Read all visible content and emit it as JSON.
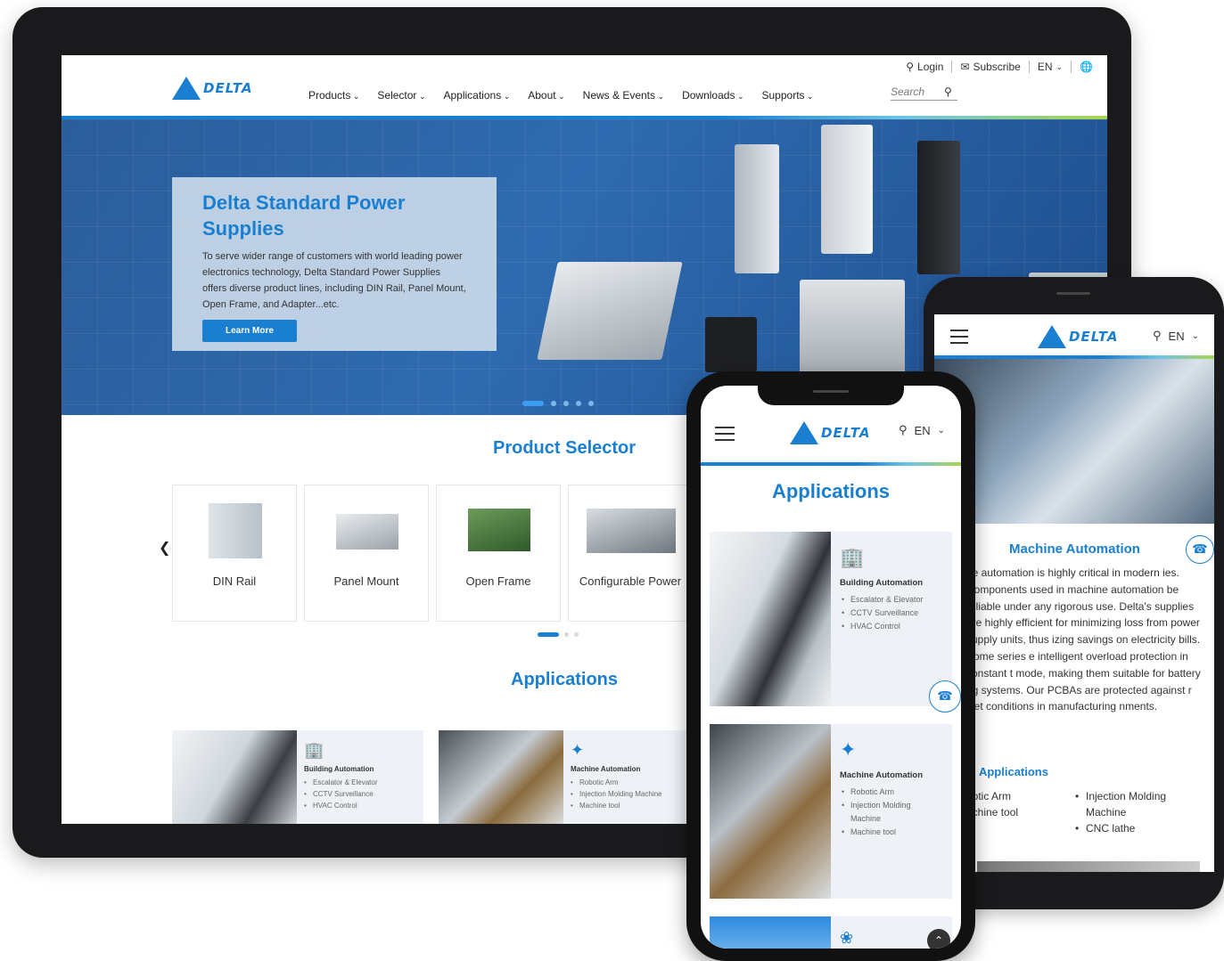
{
  "desktop": {
    "utility": {
      "login": "Login",
      "subscribe": "Subscribe",
      "language": "EN"
    },
    "logo_text": "DELTA",
    "nav": [
      "Products",
      "Selector",
      "Applications",
      "About",
      "News & Events",
      "Downloads",
      "Supports"
    ],
    "search_placeholder": "Search",
    "hero": {
      "title": "Delta Standard Power Supplies",
      "text": "To serve wider range of customers with world leading power electronics technology, Delta Standard Power Supplies offers diverse product lines, including DIN Rail, Panel Mount, Open Frame, and Adapter...etc.",
      "button": "Learn More"
    },
    "product_selector": {
      "title": "Product Selector",
      "cards": [
        "DIN Rail",
        "Panel Mount",
        "Open Frame",
        "Configurable Power"
      ]
    },
    "applications": {
      "title": "Applications",
      "items": [
        {
          "name": "Building Automation",
          "bullets": [
            "Escalator & Elevator",
            "CCTV Surveillance",
            "HVAC Control"
          ]
        },
        {
          "name": "Machine Automation",
          "bullets": [
            "Robotic Arm",
            "Injection Molding Machine",
            "Machine tool"
          ]
        }
      ]
    }
  },
  "tablet": {
    "logo_text": "DELTA",
    "language": "EN",
    "title": "Machine Automation",
    "body": "ne automation is highly critical in modern ies. Components used in machine automation be reliable under any rigorous use. Delta's supplies are highly efficient for minimizing loss from power supply units, thus izing savings on electricity bills. Some series e intelligent overload protection in constant t mode, making them suitable for battery ng systems. Our PCBAs are protected against r wet conditions in manufacturing nments.",
    "sub_title": "al Applications",
    "list_left": [
      "botic Arm",
      "achine tool"
    ],
    "list_right": [
      "Injection Molding Machine",
      "CNC lathe"
    ]
  },
  "phone": {
    "logo_text": "DELTA",
    "language": "EN",
    "title": "Applications",
    "cards": [
      {
        "name": "Building Automation",
        "bullets": [
          "Escalator & Elevator",
          "CCTV Surveillance",
          "HVAC Control"
        ]
      },
      {
        "name": "Machine Automation",
        "bullets": [
          "Robotic Arm",
          "Injection Molding Machine",
          "Machine tool"
        ]
      }
    ]
  },
  "colors": {
    "brand_blue": "#1a7fd1",
    "accent_green": "#a8d64d",
    "hero_bg": "#2f6bb0"
  },
  "icons": [
    "user-icon",
    "mail-icon",
    "globe-icon",
    "search-icon",
    "hamburger-icon",
    "contact-icon",
    "building-icon",
    "robot-arm-icon",
    "plant-icon",
    "scroll-top-icon"
  ]
}
